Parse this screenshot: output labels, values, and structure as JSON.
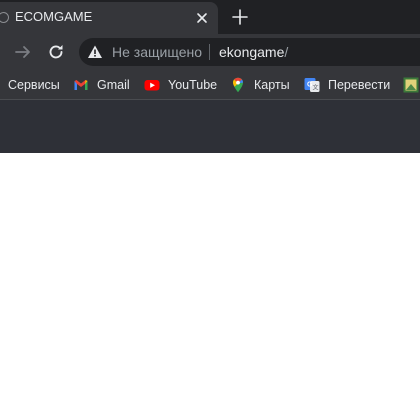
{
  "tab": {
    "title": "ECOMGAME"
  },
  "omnibox": {
    "security_label": "Не защищено",
    "url_host": "ekongame",
    "url_path": "/"
  },
  "bookmarks": [
    {
      "label": "Сервисы",
      "icon": "apps-grid-icon"
    },
    {
      "label": "Gmail",
      "icon": "gmail-icon"
    },
    {
      "label": "YouTube",
      "icon": "youtube-icon"
    },
    {
      "label": "Карты",
      "icon": "maps-pin-icon"
    },
    {
      "label": "Перевести",
      "icon": "translate-icon"
    }
  ],
  "colors": {
    "tabstrip": "#202124",
    "toolbar": "#35363a",
    "omnibox": "#202124",
    "content_header": "#2e3037",
    "page": "#ffffff"
  }
}
